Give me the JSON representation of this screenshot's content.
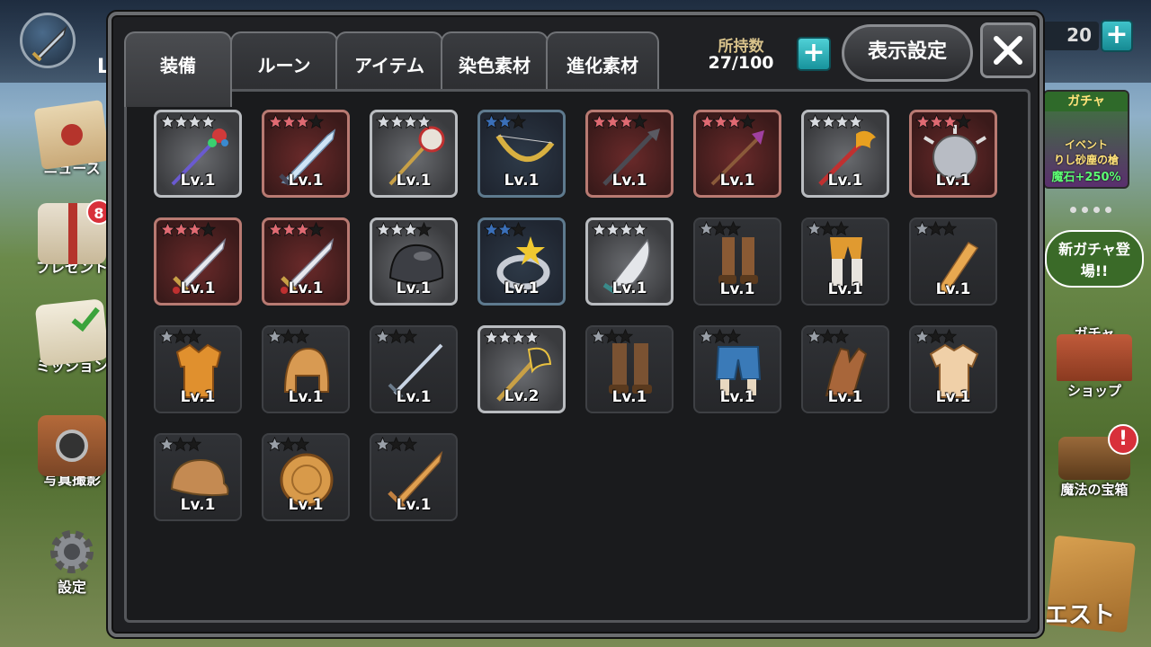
{
  "background": {
    "level_label": "L",
    "count_value": "20",
    "count_plus": "+",
    "side_menu": [
      {
        "label": "ニュース",
        "icon": "envelope-icon"
      },
      {
        "label": "プレゼント",
        "icon": "gift-icon",
        "badge": "8"
      },
      {
        "label": "ミッション",
        "icon": "quill-checklist-icon"
      },
      {
        "label": "写真撮影",
        "icon": "camera-icon"
      },
      {
        "label": "設定",
        "icon": "gear-icon"
      }
    ],
    "gacha_banner": {
      "title": "ガチャ",
      "line1": "イベント",
      "line2": "りし砂塵の槍",
      "line3": "魔石+250%"
    },
    "right_menu": [
      {
        "label": "新ガチャ登場!!",
        "sub": "ガチャ"
      },
      {
        "label": "ショップ"
      },
      {
        "label": "魔法の宝箱",
        "alert": "!"
      }
    ],
    "quest_label": "エスト"
  },
  "modal": {
    "tabs": [
      {
        "label": "装備",
        "active": true
      },
      {
        "label": "ルーン",
        "active": false
      },
      {
        "label": "アイテム",
        "active": false
      },
      {
        "label": "染色素材",
        "active": false
      },
      {
        "label": "進化素材",
        "active": false
      }
    ],
    "inventory_title": "所持数",
    "inventory_count": "27/100",
    "plus_label": "+",
    "display_settings_label": "表示設定",
    "close_icon": "close-icon",
    "items": [
      {
        "type": "staff-jeweled",
        "rarity": "gold",
        "stars": 4,
        "level": "Lv.1"
      },
      {
        "type": "greatsword",
        "rarity": "red",
        "stars": 3,
        "level": "Lv.1"
      },
      {
        "type": "ornate-mace",
        "rarity": "gold",
        "stars": 4,
        "level": "Lv.1"
      },
      {
        "type": "bow",
        "rarity": "blue",
        "stars": 2,
        "level": "Lv.1"
      },
      {
        "type": "dark-lance",
        "rarity": "red",
        "stars": 3,
        "level": "Lv.1"
      },
      {
        "type": "trident-spear",
        "rarity": "red",
        "stars": 3,
        "level": "Lv.1"
      },
      {
        "type": "fire-staff",
        "rarity": "gold",
        "stars": 4,
        "level": "Lv.1"
      },
      {
        "type": "spiked-gauntlet",
        "rarity": "red",
        "stars": 3,
        "level": "Lv.1"
      },
      {
        "type": "sword",
        "rarity": "red",
        "stars": 3,
        "level": "Lv.1"
      },
      {
        "type": "sword",
        "rarity": "red",
        "stars": 3,
        "level": "Lv.1"
      },
      {
        "type": "steel-helmet",
        "rarity": "gold",
        "stars": 3,
        "level": "Lv.1"
      },
      {
        "type": "star-ring",
        "rarity": "blue",
        "stars": 2,
        "level": "Lv.1"
      },
      {
        "type": "curved-blade",
        "rarity": "gold",
        "stars": 4,
        "level": "Lv.1"
      },
      {
        "type": "leather-boots",
        "rarity": "plain",
        "stars": 1,
        "level": "Lv.1"
      },
      {
        "type": "leggings",
        "rarity": "plain",
        "stars": 1,
        "level": "Lv.1"
      },
      {
        "type": "arm-guard",
        "rarity": "plain",
        "stars": 1,
        "level": "Lv.1"
      },
      {
        "type": "orange-armor",
        "rarity": "plain",
        "stars": 1,
        "level": "Lv.1"
      },
      {
        "type": "leather-cap-helmet",
        "rarity": "plain",
        "stars": 1,
        "level": "Lv.1"
      },
      {
        "type": "thin-sword",
        "rarity": "plain",
        "stars": 1,
        "level": "Lv.1"
      },
      {
        "type": "golden-axe",
        "rarity": "gold",
        "stars": 4,
        "level": "Lv.2"
      },
      {
        "type": "tall-boots",
        "rarity": "plain",
        "stars": 1,
        "level": "Lv.1"
      },
      {
        "type": "shorts",
        "rarity": "plain",
        "stars": 1,
        "level": "Lv.1"
      },
      {
        "type": "leather-glove",
        "rarity": "plain",
        "stars": 1,
        "level": "Lv.1"
      },
      {
        "type": "tunic",
        "rarity": "plain",
        "stars": 1,
        "level": "Lv.1"
      },
      {
        "type": "cap",
        "rarity": "plain",
        "stars": 1,
        "level": "Lv.1"
      },
      {
        "type": "round-shield",
        "rarity": "plain",
        "stars": 1,
        "level": "Lv.1"
      },
      {
        "type": "wooden-sword",
        "rarity": "plain",
        "stars": 1,
        "level": "Lv.1"
      }
    ],
    "star_colors": {
      "gold": "#d8dbe0",
      "red": "#e06a72",
      "blue": "#3a6fb8",
      "plain": "#9aa0a8",
      "empty": "#1a1a1a"
    }
  }
}
